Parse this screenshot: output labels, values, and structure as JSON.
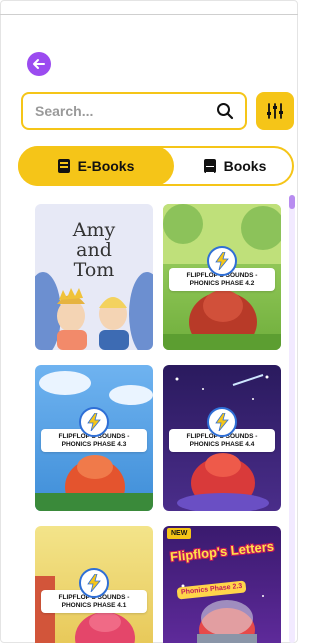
{
  "header": {
    "back_icon": "arrow-left-icon",
    "accent": "#9b4bf0"
  },
  "search": {
    "placeholder": "Search...",
    "value": "",
    "search_icon": "magnifier-icon",
    "filter_icon": "sliders-icon"
  },
  "tabs": [
    {
      "label": "E-Books",
      "icon": "ebook-icon",
      "active": true
    },
    {
      "label": "Books",
      "icon": "book-icon",
      "active": false
    }
  ],
  "brand_color": "#f5c518",
  "books": [
    {
      "title": "Amy\nand\nTom",
      "banner": "",
      "tag": ""
    },
    {
      "title": "",
      "banner": "FLIPFLOP'S SOUNDS - PHONICS PHASE 4.2",
      "tag": ""
    },
    {
      "title": "",
      "banner": "FLIPFLOP'S SOUNDS - PHONICS PHASE 4.3",
      "tag": ""
    },
    {
      "title": "",
      "banner": "FLIPFLOP'S SOUNDS - PHONICS PHASE 4.4",
      "tag": ""
    },
    {
      "title": "",
      "banner": "FLIPFLOP'S SOUNDS - PHONICS PHASE 4.1",
      "tag": ""
    },
    {
      "title": "Flipflop's Letters",
      "banner": "Phonics Phase 2.3",
      "tag": "NEW"
    }
  ]
}
